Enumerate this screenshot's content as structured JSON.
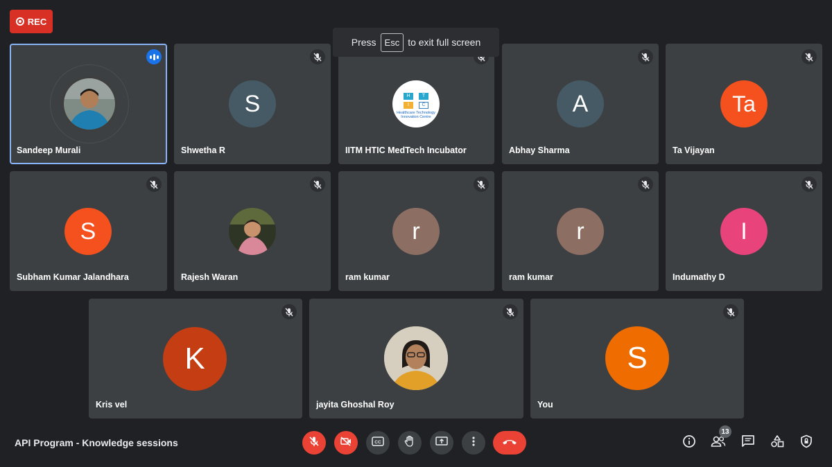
{
  "recording": {
    "label": "REC"
  },
  "fullscreen_tip": {
    "before": "Press",
    "key": "Esc",
    "after": "to exit full screen"
  },
  "participants": [
    {
      "name": "Sandeep Murali",
      "avatar": "photo",
      "speaking": true
    },
    {
      "name": "Shwetha R",
      "initials": "S",
      "color": "#455a64",
      "muted": true
    },
    {
      "name": "IITM HTIC MedTech Incubator",
      "avatar": "logo",
      "muted": true
    },
    {
      "name": "Abhay Sharma",
      "initials": "A",
      "color": "#455a64",
      "muted": true
    },
    {
      "name": "Ta Vijayan",
      "initials": "Ta",
      "color": "#f4511e",
      "muted": true
    },
    {
      "name": "Subham Kumar Jalandhara",
      "initials": "S",
      "color": "#f4511e",
      "muted": true
    },
    {
      "name": "Rajesh Waran",
      "avatar": "photo",
      "muted": true
    },
    {
      "name": "ram kumar",
      "initials": "r",
      "color": "#8d6e63",
      "muted": true
    },
    {
      "name": "ram kumar",
      "initials": "r",
      "color": "#8d6e63",
      "muted": true
    },
    {
      "name": "Indumathy D",
      "initials": "I",
      "color": "#e8437b",
      "muted": true
    },
    {
      "name": "Kris vel",
      "initials": "K",
      "color": "#c53d13",
      "muted": true
    },
    {
      "name": "jayita Ghoshal Roy",
      "avatar": "photo",
      "muted": true
    },
    {
      "name": "You",
      "initials": "S",
      "color": "#ef6c00",
      "muted": true
    }
  ],
  "logo": {
    "cells": [
      "H",
      "T",
      "I",
      "C"
    ],
    "line1": "Healthcare Technology",
    "line2": "Innovation Centre"
  },
  "bottom_bar": {
    "meeting_title": "API Program - Knowledge sessions",
    "participant_count": "13",
    "controls": [
      "mic-off-icon",
      "camera-off-icon",
      "captions-icon",
      "raise-hand-icon",
      "present-screen-icon",
      "more-options-icon",
      "end-call-icon"
    ],
    "right_icons": [
      "info-icon",
      "people-icon",
      "chat-icon",
      "activities-icon",
      "host-controls-icon"
    ]
  },
  "colors": {
    "background": "#202124",
    "tile": "#3c4043",
    "accent": "#8ab4f8",
    "danger": "#ea4335"
  }
}
